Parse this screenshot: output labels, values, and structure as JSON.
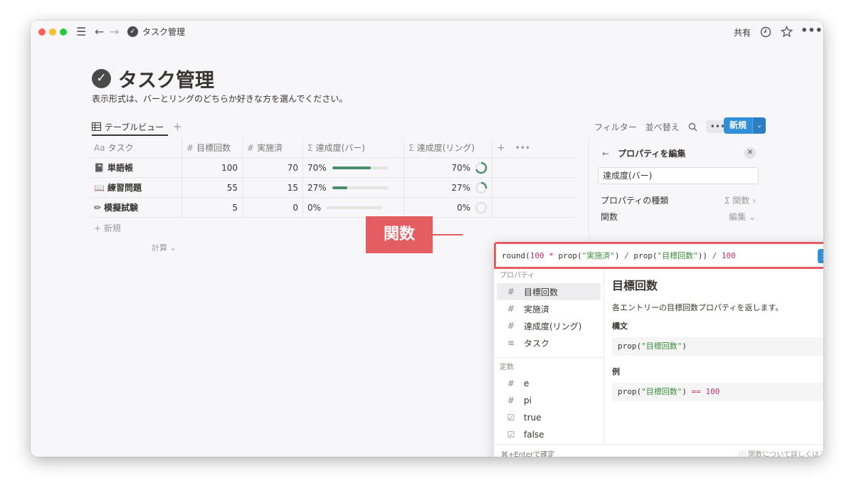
{
  "window": {
    "breadcrumb_title": "タスク管理",
    "share_label": "共有"
  },
  "page": {
    "title": "タスク管理",
    "description": "表示形式は、バーとリングのどちらか好きな方を選んでください。"
  },
  "view": {
    "tab_label": "テーブルビュー",
    "filter_label": "フィルター",
    "sort_label": "並べ替え",
    "new_label": "新規"
  },
  "table": {
    "headers": [
      "タスク",
      "目標回数",
      "実施済",
      "達成度(バー)",
      "達成度(リング)"
    ],
    "rows": [
      {
        "task": "単語帳",
        "target": "100",
        "done": "70",
        "bar_text": "70%",
        "bar_value": 70,
        "ring_text": "70%",
        "ring_value": 70
      },
      {
        "task": "練習問題",
        "target": "55",
        "done": "15",
        "bar_text": "27%",
        "bar_value": 27,
        "ring_text": "27%",
        "ring_value": 27
      },
      {
        "task": "模擬試験",
        "target": "5",
        "done": "0",
        "bar_text": "0%",
        "bar_value": 0,
        "ring_text": "0%",
        "ring_value": 0
      }
    ],
    "add_row_label": "新規",
    "calc_label": "計算"
  },
  "property_panel": {
    "title": "プロパティを編集",
    "name_value": "達成度(バー)",
    "type_label": "プロパティの種類",
    "type_value": "関数",
    "func_label": "関数",
    "func_value": "編集"
  },
  "callout": {
    "label": "関数"
  },
  "formula": {
    "done_label": "完了",
    "sections": {
      "properties": "プロパティ",
      "constants": "定数"
    },
    "properties": [
      "目標回数",
      "実施済",
      "達成度(リング)",
      "タスク"
    ],
    "constants": [
      "e",
      "pi",
      "true",
      "false"
    ],
    "detail": {
      "title": "目標回数",
      "description": "各エントリーの目標回数プロパティを返します。",
      "syntax_heading": "構文",
      "example_heading": "例"
    },
    "footer_left": "⌘+Enterで確定",
    "footer_right": "関数について詳しくはこちら"
  },
  "colors": {
    "accent_blue": "#2f8fd8",
    "highlight_red": "#e45d61",
    "progress_green": "#4b8c6b"
  }
}
